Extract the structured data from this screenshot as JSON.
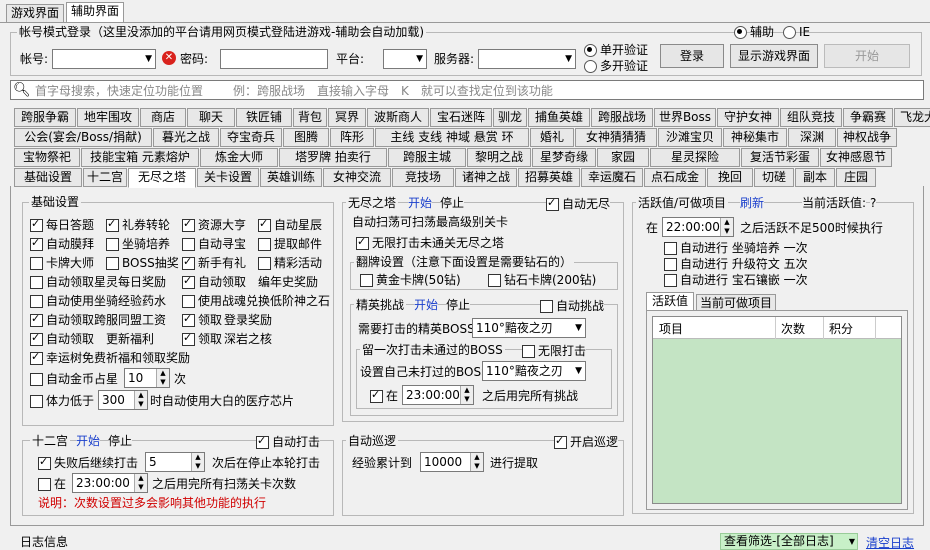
{
  "top_tabs": [
    "游戏界面",
    "辅助界面"
  ],
  "login": {
    "group_title": "帐号模式登录（这里没添加的平台请用网页模式登陆进游戏-辅助会自动加载)",
    "mode_fuzhu": "辅助",
    "mode_ie": "IE",
    "account_label": "帐号:",
    "password_label": "密码:",
    "platform_label": "平台:",
    "server_label": "服务器:",
    "single_verify": "单开验证",
    "multi_verify": "多开验证",
    "login_btn": "登录",
    "show_game_btn": "显示游戏界面",
    "start_btn": "开始"
  },
  "search": {
    "placeholder": "首字母搜索，快速定位功能位置",
    "hint": "例：跨服战场　直接输入字母　K　就可以查找定位到该功能"
  },
  "func_tabs": [
    [
      "跨服争霸",
      "地牢围攻",
      "商店",
      "聊天",
      "铁匠铺",
      "背包",
      "冥界",
      "波斯商人",
      "宝石迷阵",
      "驯龙",
      "捕鱼英雄",
      "跨服战场",
      "世界Boss",
      "守护女神",
      "组队竞技",
      "争霸赛",
      "飞龙大赛"
    ],
    [
      "公会(宴会/Boss/捐献)",
      "暮光之战",
      "夺宝奇兵",
      "图腾",
      "阵形",
      "主线 支线 神域 悬赏 环",
      "婚礼",
      "女神猜猜猜",
      "沙滩宝贝",
      "神秘集市",
      "深渊",
      "神权战争"
    ],
    [
      "宝物祭祀",
      "技能宝箱 元素熔炉",
      "炼金大师",
      "塔罗牌 拍卖行",
      "跨服主城",
      "黎明之战",
      "星梦奇缘",
      "家园",
      "星灵探险",
      "复活节彩蛋",
      "女神感恩节"
    ],
    [
      "基础设置",
      "十二宫",
      "无尽之塔",
      "关卡设置",
      "英雄训练",
      "女神交流",
      "竞技场",
      "诸神之战",
      "招募英雄",
      "幸运魔石",
      "点石成金",
      "挽回",
      "切磋",
      "副本",
      "庄园"
    ]
  ],
  "basic": {
    "title": "基础设置",
    "items": [
      "每日答题",
      "礼券转轮",
      "资源大亨",
      "自动星辰",
      "自动膜拜",
      "坐骑培养",
      "自动寻宝",
      "提取邮件",
      "卡牌大师",
      "BOSS抽奖",
      "新手有礼",
      "精彩活动",
      "自动领取星灵每日奖励",
      "自动领取",
      "编年史奖励",
      "自动使用坐骑经验药水",
      "使用战魂兑换低阶神之石",
      "自动领取跨服同盟工资",
      "领取",
      "登录奖励",
      "自动领取",
      "更新福利",
      "领取",
      "深岩之核",
      "幸运树免费祈福和领取奖励",
      "自动金币占星",
      "体力低于"
    ],
    "star_value": "10",
    "star_unit": "次",
    "hp_value": "300",
    "hp_suffix": "时自动使用大白的医疗芯片"
  },
  "zodiac": {
    "title": "十二宫",
    "start": "开始",
    "stop": "停止",
    "auto_attack": "自动打击",
    "fail_retry": "失败后继续打击",
    "fail_value": "5",
    "fail_suffix": "次后在停止本轮打击",
    "at": "在",
    "time": "23:00:00",
    "time_suffix": "之后用完所有扫荡关卡次数",
    "note": "说明：次数设置过多会影响其他功能的执行"
  },
  "tower": {
    "title": "无尽之塔",
    "start": "开始",
    "stop": "停止",
    "auto": "自动无尽",
    "line1": "自动扫荡可扫荡最高级别关卡",
    "infinite": "无限打击未通关无尽之塔",
    "flip_title": "翻牌设置（注意下面设置是需要钻石的）",
    "gold_card": "黄金卡牌(50钻)",
    "diamond_card": "钻石卡牌(200钻)"
  },
  "elite": {
    "title": "精英挑战",
    "start": "开始",
    "stop": "停止",
    "auto": "自动挑战",
    "need_boss": "需要打击的精英BOSS",
    "need_boss_value": "110°黯夜之刃",
    "leave_once": "留一次打击未通过的BOSS",
    "infinite": "无限打击",
    "set_boss": "设置自己未打过的BOSS",
    "set_boss_value": "110°黯夜之刃",
    "at": "在",
    "time": "23:00:00",
    "time_suffix": "之后用完所有挑战"
  },
  "patrol": {
    "title": "自动巡逻",
    "open": "开启巡逻",
    "exp_label": "经验累计到",
    "exp_value": "10000",
    "exp_suffix": "进行提取"
  },
  "activity": {
    "title": "活跃值/可做项目",
    "refresh": "刷新",
    "current_label": "当前活跃值:",
    "current_value": "?",
    "at": "在",
    "time": "22:00:00",
    "time_suffix": "之后活跃不足500时候执行",
    "auto1": "自动进行 坐骑培养 一次",
    "auto2": "自动进行 升级符文 五次",
    "auto3": "自动进行 宝石镶嵌 一次",
    "tabs": [
      "活跃值",
      "当前可做项目"
    ],
    "columns": [
      "项目",
      "次数",
      "积分"
    ]
  },
  "log": {
    "title": "日志信息",
    "filter": "查看筛选-[全部日志]",
    "clear": "清空日志"
  }
}
